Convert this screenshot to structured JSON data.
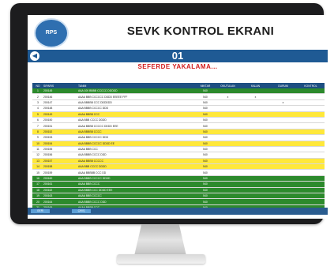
{
  "header": {
    "title": "SEVK KONTROL EKRANI",
    "logo_text": "RPS",
    "screen_number": "01",
    "status_text": "SEFERDE YAKALAMA..."
  },
  "table": {
    "columns": [
      "NO",
      "SIPARIS",
      "TANIM",
      "MIKTAR",
      "OKUTULAN",
      "KALAN",
      "DURUM",
      "KONTROL"
    ],
    "rows": [
      {
        "color": "#2c8a2c",
        "cells": [
          "1",
          "200145",
          "AAA 100 BBBB CCCCC DDDDD",
          "540",
          "",
          "",
          "",
          ""
        ]
      },
      {
        "color": "#ffffff",
        "cells": [
          "2",
          "200146",
          "AAAA BBB CCCCCC DDDD EEEEE FFF",
          "540",
          "x",
          "x",
          "",
          ""
        ]
      },
      {
        "color": "#ffffff",
        "cells": [
          "3",
          "200147",
          "AAA BBBBB CCC DDDDDD",
          "540",
          "",
          "",
          "x",
          ""
        ]
      },
      {
        "color": "#ffffff",
        "cells": [
          "4",
          "200148",
          "AAA BBBB CCCCC DDD",
          "540",
          "",
          "",
          "",
          ""
        ]
      },
      {
        "color": "#ffe83a",
        "cells": [
          "5",
          "200149",
          "AAAA BBBB CCC",
          "540",
          "",
          "",
          "",
          ""
        ]
      },
      {
        "color": "#ffffff",
        "cells": [
          "6",
          "200150",
          "AAA BBB CCCC DDDD",
          "540",
          "",
          "",
          "",
          ""
        ]
      },
      {
        "color": "#ffffff",
        "cells": [
          "7",
          "200151",
          "AAAA BBBB CCCCC DDDD EEE",
          "540",
          "",
          "",
          "",
          ""
        ]
      },
      {
        "color": "#ffe83a",
        "cells": [
          "8",
          "200152",
          "AAA BBBBB CCCC",
          "540",
          "",
          "",
          "",
          ""
        ]
      },
      {
        "color": "#ffffff",
        "cells": [
          "9",
          "200153",
          "AAAA BBB CCCCC DDD",
          "540",
          "",
          "",
          "",
          ""
        ]
      },
      {
        "color": "#ffe83a",
        "cells": [
          "10",
          "200154",
          "AAA BBBB CCCCC DDDD EE",
          "540",
          "",
          "",
          "",
          ""
        ]
      },
      {
        "color": "#ffffff",
        "cells": [
          "11",
          "200155",
          "AAAA BBB CCC",
          "540",
          "",
          "",
          "",
          ""
        ]
      },
      {
        "color": "#ffffff",
        "cells": [
          "12",
          "200156",
          "AAA BBBB CCCC DDD",
          "540",
          "",
          "",
          "",
          ""
        ]
      },
      {
        "color": "#ffe83a",
        "cells": [
          "13",
          "200157",
          "AAAA BBBB CCCCC",
          "540",
          "",
          "",
          "",
          ""
        ]
      },
      {
        "color": "#ffe83a",
        "cells": [
          "14",
          "200158",
          "AAA BBB CCCC DDDD",
          "540",
          "",
          "",
          "",
          ""
        ]
      },
      {
        "color": "#ffffff",
        "cells": [
          "15",
          "200159",
          "AAAA BBBBB CCC DD",
          "540",
          "",
          "",
          "",
          ""
        ]
      },
      {
        "color": "#2c8a2c",
        "cells": [
          "16",
          "200160",
          "AAA BBBB CCCCC DDDD",
          "540",
          "",
          "",
          "",
          ""
        ]
      },
      {
        "color": "#2c8a2c",
        "cells": [
          "17",
          "200161",
          "AAAA BBB CCCC",
          "540",
          "",
          "",
          "",
          ""
        ]
      },
      {
        "color": "#2c8a2c",
        "cells": [
          "18",
          "200162",
          "AAA BBBB CCC DDDD EEE",
          "540",
          "",
          "",
          "",
          ""
        ]
      },
      {
        "color": "#2c8a2c",
        "cells": [
          "19",
          "200163",
          "AAAA BBB CCCCC",
          "540",
          "",
          "",
          "",
          ""
        ]
      },
      {
        "color": "#2c8a2c",
        "cells": [
          "20",
          "200164",
          "AAA BBBB CCCC DDD",
          "540",
          "",
          "",
          "",
          ""
        ]
      },
      {
        "color": "#2c8a2c",
        "cells": [
          "21",
          "200165",
          "AAAA BBBB CCC",
          "540",
          "",
          "",
          "",
          ""
        ]
      }
    ]
  },
  "footer": {
    "tab1": "GERİ",
    "tab2": "ÇIKIŞ"
  }
}
